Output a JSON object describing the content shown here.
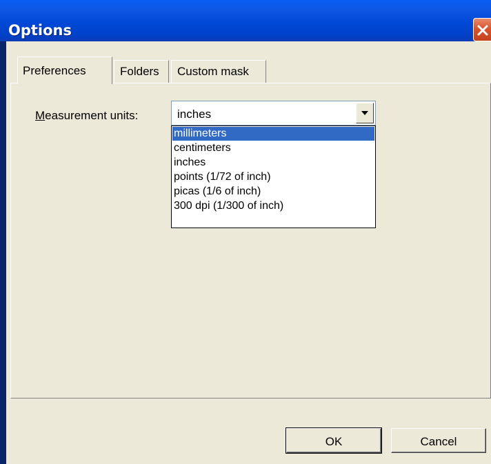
{
  "window": {
    "title": "Options",
    "close_icon": "close-icon"
  },
  "tabs": [
    {
      "label": "Preferences",
      "active": true
    },
    {
      "label": "Folders",
      "active": false
    },
    {
      "label": "Custom mask",
      "active": false
    }
  ],
  "preferences": {
    "measurement_units_label_prefix": "M",
    "measurement_units_label_rest": "easurement units:",
    "measurement_units_value": "inches",
    "options": [
      "millimeters",
      "centimeters",
      "inches",
      "points (1/72 of inch)",
      "picas  (1/6 of inch)",
      "300 dpi (1/300 of inch)"
    ],
    "highlighted_option": "millimeters"
  },
  "buttons": {
    "ok_label": "OK",
    "cancel_label": "Cancel"
  },
  "colors": {
    "titlebar": "#0049d6",
    "selection": "#316ac5",
    "face": "#ece9d8",
    "close": "#d9542e"
  }
}
